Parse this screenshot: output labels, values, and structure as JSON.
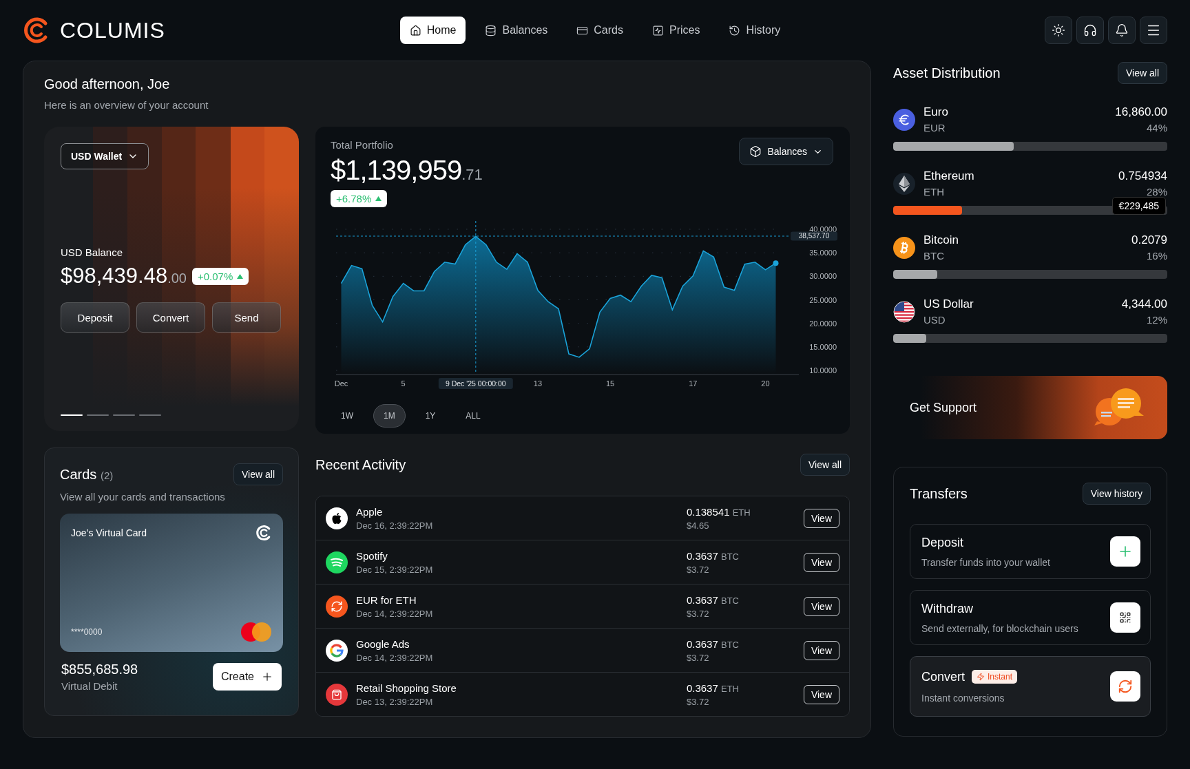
{
  "brand": {
    "name": "COLUMIS"
  },
  "nav": [
    {
      "label": "Home",
      "selected": true
    },
    {
      "label": "Balances",
      "selected": false
    },
    {
      "label": "Cards",
      "selected": false
    },
    {
      "label": "Prices",
      "selected": false
    },
    {
      "label": "History",
      "selected": false
    }
  ],
  "greeting": {
    "title": "Good afternoon, Joe",
    "subtitle": "Here is an overview of your account"
  },
  "wallet": {
    "selector": "USD Wallet",
    "label": "USD Balance",
    "amount": "$98,439.48",
    "cents": ".00",
    "change": "+0.07%",
    "actions": [
      "Deposit",
      "Convert",
      "Send"
    ],
    "pager": [
      {
        "selected": true
      },
      {
        "selected": false
      },
      {
        "selected": false
      },
      {
        "selected": false
      }
    ]
  },
  "cards": {
    "title": "Cards",
    "count": "(2)",
    "view_all": "View all",
    "subtitle": "View all your cards and transactions",
    "card": {
      "name": "Joe’s Virtual Card",
      "number": "****0000"
    },
    "balance": "$855,685.98",
    "type": "Virtual Debit",
    "create": "Create"
  },
  "portfolio": {
    "title": "Total Portfolio",
    "amount": "$1,139,959",
    "cents": ".71",
    "change": "+6.78%",
    "dropdown": "Balances",
    "chart_data": {
      "type": "area",
      "ylim": [
        10,
        40
      ],
      "grid": true,
      "categories": [
        "Dec",
        null,
        null,
        null,
        null,
        null,
        "5",
        null,
        null,
        null,
        null,
        null,
        null,
        "9 Dec '25 00:00:00",
        null,
        null,
        null,
        null,
        null,
        "13",
        null,
        null,
        null,
        null,
        null,
        null,
        "15",
        null,
        null,
        null,
        null,
        null,
        null,
        null,
        "17",
        null,
        null,
        null,
        null,
        null,
        null,
        "20",
        null
      ],
      "series": [
        {
          "color": "#1aa3d9",
          "values": [
            28.5,
            32.3,
            31.6,
            23.8,
            20.3,
            25.7,
            28.5,
            26.9,
            26.9,
            31.0,
            33.0,
            32.6,
            36.7,
            38.5,
            36.7,
            33.0,
            31.5,
            34.8,
            33.0,
            27.0,
            24.6,
            23.1,
            13.5,
            12.8,
            14.6,
            22.4,
            25.3,
            26.0,
            24.6,
            27.9,
            30.2,
            29.7,
            22.9,
            27.9,
            30.1,
            35.4,
            34.1,
            27.7,
            27.0,
            32.6,
            33.0,
            31.4,
            32.8
          ]
        }
      ],
      "yticks": [
        {
          "value": 10,
          "label": "10.0000"
        },
        {
          "value": 15,
          "label": "15.0000"
        },
        {
          "value": 20,
          "label": "20.0000"
        },
        {
          "value": 25,
          "label": "25.0000"
        },
        {
          "value": 30,
          "label": "30.0000"
        },
        {
          "value": 35,
          "label": "35.0000"
        },
        {
          "value": 40,
          "label": "40.0000"
        }
      ],
      "ref_lines": [
        {
          "axis": "y",
          "value": 38.5377,
          "label": "38,537.70"
        },
        {
          "axis": "x",
          "value": "9 Dec '25 00:00:00"
        }
      ]
    },
    "ranges": [
      {
        "label": "1W",
        "selected": false
      },
      {
        "label": "1M",
        "selected": true
      },
      {
        "label": "1Y",
        "selected": false
      },
      {
        "label": "ALL",
        "selected": false
      }
    ]
  },
  "activity": {
    "title": "Recent Activity",
    "view_all": "View all",
    "rows": [
      {
        "name": "Apple",
        "date": "Dec 16, 2:39:22PM",
        "amount": "0.138541",
        "unit": "ETH",
        "usd": "$4.65",
        "action": "View"
      },
      {
        "name": "Spotify",
        "date": "Dec 15, 2:39:22PM",
        "amount": "0.3637",
        "unit": "BTC",
        "usd": "$3.72",
        "action": "View"
      },
      {
        "name": "EUR for ETH",
        "date": "Dec 14, 2:39:22PM",
        "amount": "0.3637",
        "unit": "BTC",
        "usd": "$3.72",
        "action": "View"
      },
      {
        "name": "Google Ads",
        "date": "Dec 14, 2:39:22PM",
        "amount": "0.3637",
        "unit": "BTC",
        "usd": "$3.72",
        "action": "View"
      },
      {
        "name": "Retail Shopping Store",
        "date": "Dec 13, 2:39:22PM",
        "amount": "0.3637",
        "unit": "ETH",
        "usd": "$3.72",
        "action": "View"
      }
    ]
  },
  "assets": {
    "title": "Asset Distribution",
    "view_all": "View all",
    "items": [
      {
        "name": "Euro",
        "code": "EUR",
        "amount": "16,860.00",
        "share": "44%",
        "level": 0.44,
        "highlighted": false
      },
      {
        "name": "Ethereum",
        "code": "ETH",
        "amount": "0.754934",
        "share": "28%",
        "level": 0.25,
        "highlighted": true,
        "tooltip": "€229,485"
      },
      {
        "name": "Bitcoin",
        "code": "BTC",
        "amount": "0.2079",
        "share": "16%",
        "level": 0.16,
        "highlighted": false
      },
      {
        "name": "US Dollar",
        "code": "USD",
        "amount": "4,344.00",
        "share": "12%",
        "level": 0.12,
        "highlighted": false
      }
    ]
  },
  "support": {
    "label": "Get Support"
  },
  "transfers": {
    "title": "Transfers",
    "action": "View history",
    "items": [
      {
        "kind": "deposit",
        "title": "Deposit",
        "subtitle": "Transfer funds into your wallet",
        "highlighted": false
      },
      {
        "kind": "withdraw",
        "title": "Withdraw",
        "subtitle": "Send externally, for blockchain users",
        "highlighted": false
      },
      {
        "kind": "convert",
        "title": "Convert",
        "badge": "Instant",
        "subtitle": "Instant conversions",
        "highlighted": true
      }
    ]
  }
}
